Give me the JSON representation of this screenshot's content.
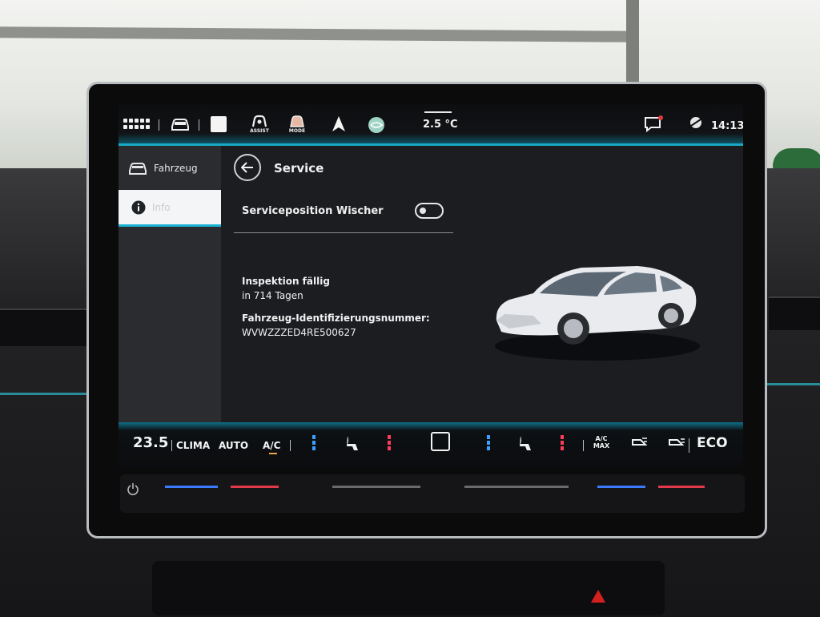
{
  "status_bar": {
    "icons": [
      "apps-grid-icon",
      "car-icon",
      "home-square-icon",
      "assist-icon",
      "mode-icon",
      "navigation-arrow-icon",
      "media-globe-icon",
      "message-icon",
      "signal-icon"
    ],
    "assist_label": "ASSIST",
    "mode_label": "MODE",
    "outside_temperature": "2.5 °C",
    "time": "14:13"
  },
  "left_nav": {
    "items": [
      {
        "label": "Fahrzeug",
        "icon": "car-icon",
        "active": false
      },
      {
        "label": "Info",
        "icon": "info-icon",
        "active": true
      }
    ]
  },
  "page": {
    "title": "Service",
    "back_icon": "back-arrow-icon"
  },
  "settings": {
    "wiper_service_label": "Serviceposition Wischer",
    "wiper_service_on": false
  },
  "service_info": {
    "inspection_label": "Inspektion fällig",
    "inspection_days": "in 714 Tagen",
    "vin_label": "Fahrzeug-Identifizierungsnummer:",
    "vin_value": "WVWZZZED4RE500627"
  },
  "climate_bar": {
    "temperature": "23.5",
    "clima_label": "CLIMA",
    "auto_label": "AUTO",
    "ac_label": "A/C",
    "ac_max_label": "A/C MAX",
    "eco_label": "ECO",
    "accent_color": "#f2a24a",
    "blue_color": "#3aa0ff",
    "red_color": "#ff3b5c"
  }
}
